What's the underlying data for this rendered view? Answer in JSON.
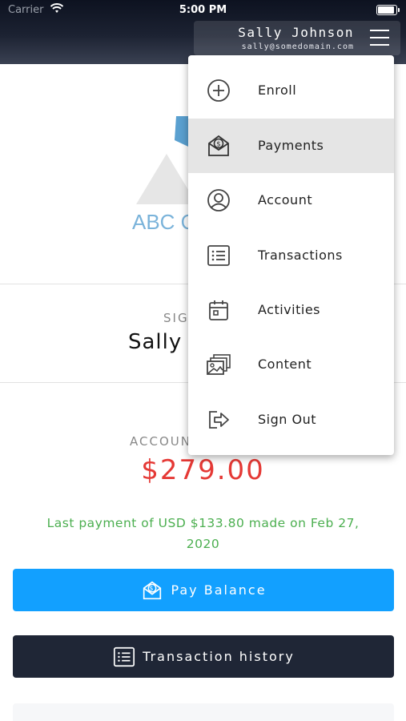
{
  "status_bar": {
    "carrier": "Carrier",
    "time": "5:00 PM"
  },
  "header": {
    "user_name": "Sally Johnson",
    "user_email": "sally@somedomain.com"
  },
  "page": {
    "logo_text": "ABC C",
    "signature_label": "SIG",
    "signature_name": "Sally",
    "account_label": "ACCOUN",
    "balance": "$279.00",
    "last_payment_line1": "Last payment of USD $133.80 made on Feb 27,",
    "last_payment_line2": "2020",
    "pay_button_label": "Pay Balance",
    "history_button_label": "Transaction history"
  },
  "menu": {
    "items": [
      {
        "label": "Enroll",
        "icon": "plus-circle-icon"
      },
      {
        "label": "Payments",
        "icon": "payment-envelope-icon",
        "active": true
      },
      {
        "label": "Account",
        "icon": "user-circle-icon"
      },
      {
        "label": "Transactions",
        "icon": "list-icon"
      },
      {
        "label": "Activities",
        "icon": "calendar-icon"
      },
      {
        "label": "Content",
        "icon": "images-icon"
      },
      {
        "label": "Sign Out",
        "icon": "sign-out-icon"
      }
    ]
  },
  "colors": {
    "header_dark": "#1c2232",
    "balance_red": "#e53935",
    "success_green": "#4caf50",
    "pay_blue": "#12a0ff",
    "history_dark": "#1f2636",
    "logo_blue": "#7ab3da",
    "menu_active": "#e5e5e5"
  }
}
